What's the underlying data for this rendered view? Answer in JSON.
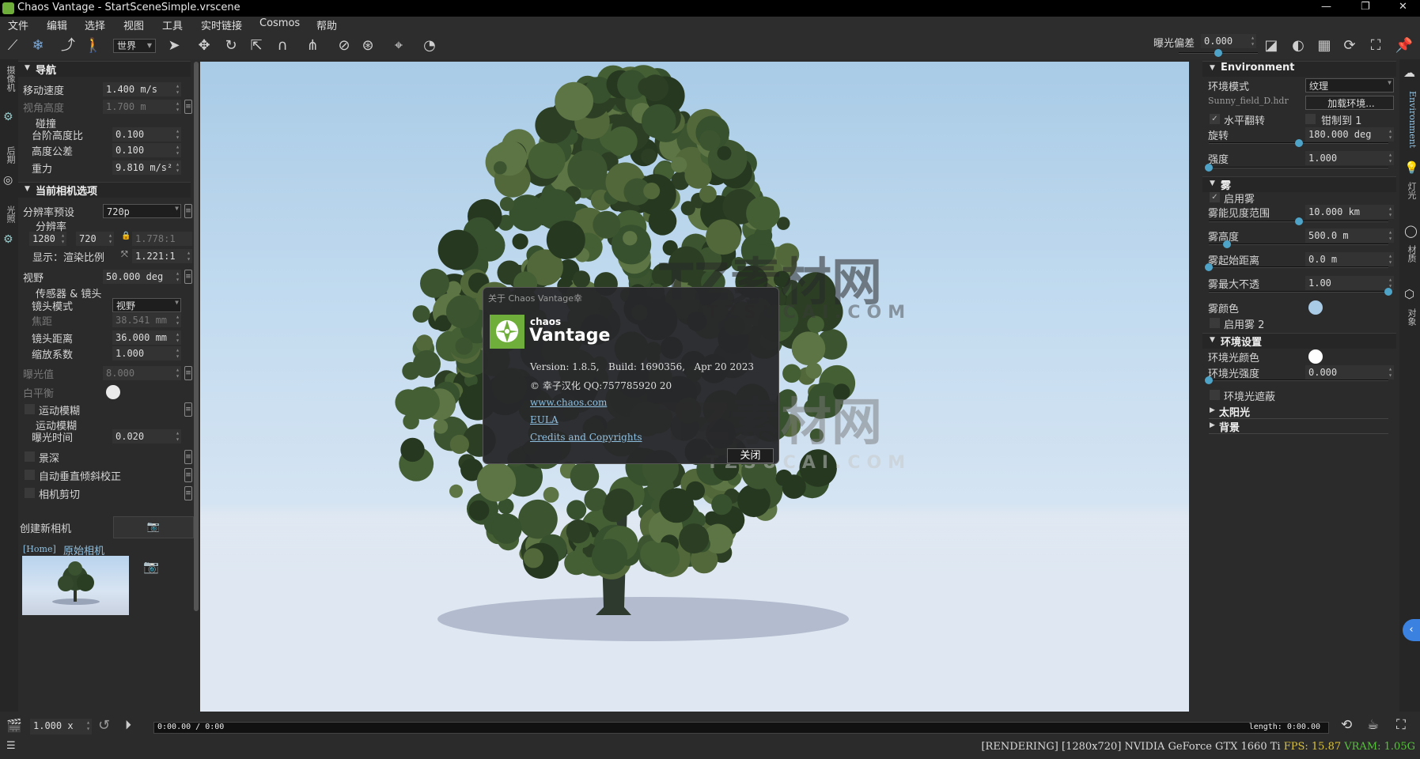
{
  "window": {
    "title": "Chaos Vantage - StartSceneSimple.vrscene",
    "minimize": "—",
    "maximize": "❐",
    "close": "✕"
  },
  "menu": [
    "文件",
    "编辑",
    "选择",
    "视图",
    "工具",
    "实时链接",
    "Cosmos",
    "帮助"
  ],
  "toolbar": {
    "coord_space": "世界",
    "exposure_label": "曝光偏差",
    "exposure_value": "0.000",
    "exposure_slider": 0.5
  },
  "left_tabs": [
    "摄像机",
    "后期",
    "光照"
  ],
  "left_panel": {
    "rows": [
      {
        "kind": "header",
        "label": "导航"
      },
      {
        "kind": "field",
        "label": "移动速度",
        "value": "1.400 m/s"
      },
      {
        "kind": "field",
        "label": "视角高度",
        "value": "1.700 m",
        "disabled": true,
        "menu": true
      },
      {
        "kind": "sub",
        "label": "碰撞"
      },
      {
        "kind": "field",
        "label": "台阶高度比",
        "value": "0.100",
        "indent": true
      },
      {
        "kind": "field",
        "label": "高度公差",
        "value": "0.100",
        "indent": true
      },
      {
        "kind": "field",
        "label": "重力",
        "value": "9.810 m/s²",
        "indent": true
      },
      {
        "kind": "header",
        "label": "当前相机选项"
      },
      {
        "kind": "dropdown",
        "label": "分辨率预设",
        "value": "720p",
        "menu": true
      },
      {
        "kind": "sub",
        "label": "分辨率"
      },
      {
        "kind": "res",
        "width": "1280",
        "height": "720",
        "ratio": "1.778:1"
      },
      {
        "kind": "ratio",
        "label": "显示：渲染比例",
        "value": "1.221:1"
      },
      {
        "kind": "field",
        "label": "视野",
        "value": "50.000 deg",
        "menu": true
      },
      {
        "kind": "sub",
        "label": "传感器 & 镜头"
      },
      {
        "kind": "dropdown",
        "label": "镜头模式",
        "value": "视野",
        "indent": true
      },
      {
        "kind": "field",
        "label": "焦距",
        "value": "38.541 mm",
        "indent": true,
        "disabled": true
      },
      {
        "kind": "field",
        "label": "镜头距离",
        "value": "36.000 mm",
        "indent": true
      },
      {
        "kind": "field",
        "label": "缩放系数",
        "value": "1.000",
        "indent": true
      },
      {
        "kind": "field",
        "label": "曝光值",
        "value": "8.000",
        "disabled": true,
        "menu": true
      },
      {
        "kind": "color",
        "label": "白平衡",
        "color": "#ffffff",
        "disabled": true
      },
      {
        "kind": "check",
        "label": "运动模糊",
        "checked": false,
        "menu": true
      },
      {
        "kind": "sub",
        "label": "运动模糊"
      },
      {
        "kind": "field",
        "label": "曝光时间",
        "value": "0.020",
        "indent": true
      },
      {
        "kind": "check",
        "label": "景深",
        "checked": false,
        "menu": true
      },
      {
        "kind": "check",
        "label": "自动垂直倾斜校正",
        "checked": false,
        "menu": true
      },
      {
        "kind": "check",
        "label": "相机剪切",
        "checked": false,
        "menu": true
      }
    ],
    "create_camera": "创建新相机",
    "camera_tag": "[Home]",
    "camera_name": "原始相机"
  },
  "right_panel": {
    "rows": [
      {
        "kind": "header",
        "label": "Environment"
      },
      {
        "kind": "dropdown",
        "label": "环境模式",
        "value": "纹理"
      },
      {
        "kind": "button",
        "label": "Sunny_field_D.hdr",
        "value": "加载环境..."
      },
      {
        "kind": "check2",
        "label": "水平翻转",
        "checked": true,
        "label2": "钳制到 1",
        "checked2": false
      },
      {
        "kind": "field",
        "label": "旋转",
        "value": "180.000 deg"
      },
      {
        "kind": "slider",
        "value": 0.5
      },
      {
        "kind": "field",
        "label": "强度",
        "value": "1.000"
      },
      {
        "kind": "slider",
        "value": 0.0
      },
      {
        "kind": "header",
        "label": "雾"
      },
      {
        "kind": "check",
        "label": "启用雾",
        "checked": true
      },
      {
        "kind": "field",
        "label": "雾能见度范围",
        "value": "10.000 km"
      },
      {
        "kind": "slider",
        "value": 0.5
      },
      {
        "kind": "field",
        "label": "雾高度",
        "value": "500.0 m"
      },
      {
        "kind": "slider",
        "value": 0.1
      },
      {
        "kind": "field",
        "label": "雾起始距离",
        "value": "0.0 m"
      },
      {
        "kind": "slider",
        "value": 0.0
      },
      {
        "kind": "field",
        "label": "雾最大不透",
        "value": "1.00"
      },
      {
        "kind": "slider",
        "value": 1.0
      },
      {
        "kind": "color",
        "label": "雾颜色",
        "color": "#a9cbe6"
      },
      {
        "kind": "check",
        "label": "启用雾 2",
        "checked": false
      },
      {
        "kind": "header",
        "label": "环境设置"
      },
      {
        "kind": "color",
        "label": "环境光颜色",
        "color": "#ffffff"
      },
      {
        "kind": "field",
        "label": "环境光强度",
        "value": "0.000"
      },
      {
        "kind": "slider",
        "value": 0.0
      },
      {
        "kind": "check",
        "label": "环境光遮蔽",
        "checked": false
      },
      {
        "kind": "collapsed",
        "label": "太阳光"
      },
      {
        "kind": "collapsed",
        "label": "背景"
      }
    ]
  },
  "right_tabs": [
    "Environment",
    "灯光",
    "材质",
    "对象"
  ],
  "dialog": {
    "title": "关于 Chaos Vantage幸",
    "brand_small": "chaos",
    "brand_large": "Vantage",
    "version_line": "Version: 1.8.5,   Build: 1690356,   Apr 20 2023",
    "credit_line": "© 幸子汉化 QQ:757785920 20",
    "link_site": "www.chaos.com",
    "link_eula": "EULA",
    "link_credits": "Credits and Copyrights",
    "close_button": "关闭",
    "accent": "#6fae3a"
  },
  "watermark": {
    "text": "TZ素材网",
    "sub": "TZSUCAI.COM"
  },
  "timeline": {
    "speed": "1.000 x",
    "time": "0:00.00 / 0:00",
    "length": "length: 0:00.00"
  },
  "status": {
    "state": "[RENDERING]",
    "resolution": "[1280x720]",
    "gpu": "NVIDIA GeForce GTX 1660 Ti",
    "fps_label": "FPS:",
    "fps": "15.87",
    "vram_label": "VRAM:",
    "vram": "1.05G",
    "fps_color": "#d9c23a",
    "vram_color": "#56c23a"
  }
}
